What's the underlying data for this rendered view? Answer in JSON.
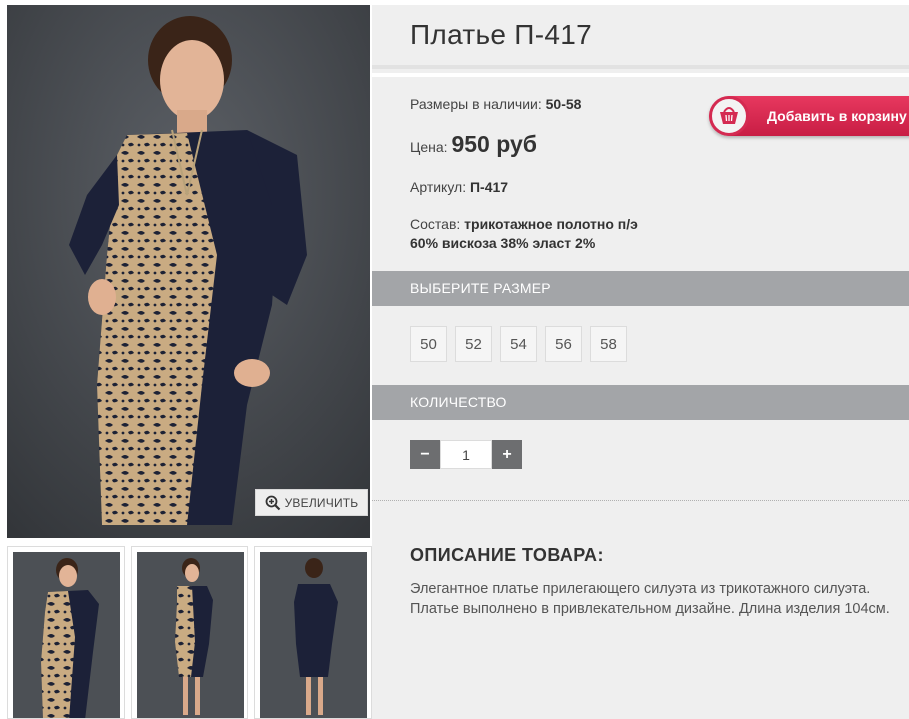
{
  "product": {
    "title": "Платье П-417",
    "sizes_label": "Размеры в наличии:",
    "sizes_value": "50-58",
    "price_label": "Цена:",
    "price_value": "950 руб",
    "article_label": "Артикул:",
    "article_value": "П-417",
    "composition_label": "Состав:",
    "composition_line1": "трикотажное полотно п/э",
    "composition_line2": "60% вискоза 38% эласт 2%"
  },
  "cart": {
    "label": "Добавить в корзину",
    "icon": "basket-icon"
  },
  "gallery": {
    "zoom_label": "УВЕЛИЧИТЬ",
    "zoom_icon": "zoom-in-icon"
  },
  "size_section": {
    "heading": "ВЫБЕРИТЕ РАЗМЕР",
    "options": [
      "50",
      "52",
      "54",
      "56",
      "58"
    ]
  },
  "quantity_section": {
    "heading": "КОЛИЧЕСТВО",
    "value": "1",
    "minus": "−",
    "plus": "+"
  },
  "description": {
    "heading": "ОПИСАНИЕ ТОВАРА:",
    "text": "Элегантное платье прилегающего силуэта из трикотажного силуэта. Платье выполнено в привлекательном дизайне. Длина изделия 104см."
  },
  "colors": {
    "accent": "#d42a51",
    "section_bar": "#a3a5a8",
    "panel": "#efefef"
  }
}
